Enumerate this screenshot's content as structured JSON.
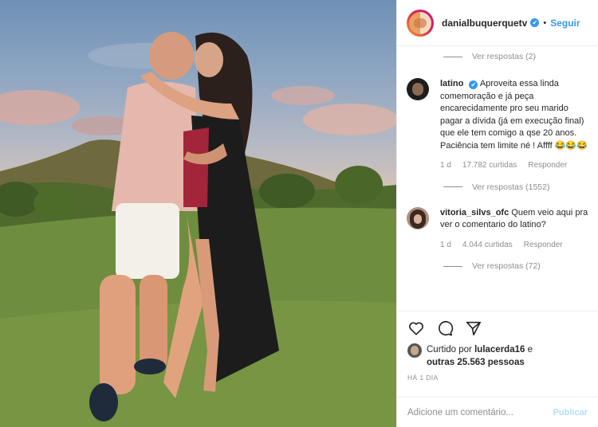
{
  "header": {
    "username": "danialbuquerquetv",
    "verified_glyph": "✔",
    "separator": "•",
    "follow_label": "Seguir"
  },
  "comments": {
    "top_replies": "Ver respostas (2)",
    "items": [
      {
        "username": "latino",
        "text": "Aproveita essa linda comemoração e já peça encarecidamente pro seu marido pagar a dívida (já em execução final) que ele tem comigo a qse 20 anos. Paciência tem limite né ! Affff 😂😂😂",
        "time": "1 d",
        "likes": "17.782 curtidas",
        "reply": "Responder",
        "view_replies": "Ver respostas (1552)"
      },
      {
        "username": "vitoria_silvs_ofc",
        "text": "Quem veio aqui pra ver o comentario do latino?",
        "time": "1 d",
        "likes": "4.044 curtidas",
        "reply": "Responder",
        "view_replies": "Ver respostas (72)"
      }
    ]
  },
  "actions": {
    "icons": [
      "heart-icon",
      "comment-icon",
      "share-icon"
    ],
    "liked_prefix": "Curtido por",
    "liked_user": "lulacerda16",
    "liked_suffix": "e",
    "liked_others": "outras 25.563 pessoas",
    "timestamp": "HÁ 1 DIA"
  },
  "add_comment": {
    "placeholder": "Adicione um comentário...",
    "post_label": "Publicar"
  },
  "colors": {
    "accent": "#3897f0",
    "muted": "#8e8e8e",
    "border": "#efefef"
  }
}
